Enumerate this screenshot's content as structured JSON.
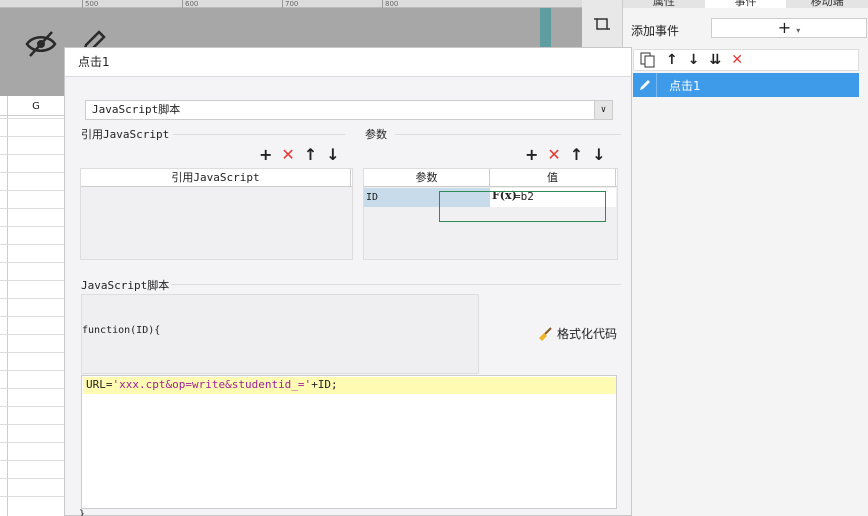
{
  "ruler": {
    "ticks": [
      "500",
      "600",
      "700",
      "800"
    ]
  },
  "grid": {
    "column_label": "G"
  },
  "side_panel": {
    "tabs": [
      "属性",
      "事件",
      "移动端"
    ],
    "add_event_label": "添加事件",
    "add_event_value": "+",
    "events": [
      "点击1"
    ]
  },
  "dialog": {
    "title": "点击1",
    "type_select": "JavaScript脚本",
    "ref_section": "引用JavaScript",
    "ref_column": "引用JavaScript",
    "param_section": "参数",
    "param_columns": [
      "参数",
      "值"
    ],
    "params": [
      {
        "name": "ID",
        "fx": "F(x)",
        "value": "=b2"
      }
    ],
    "script_section": "JavaScript脚本",
    "function_header": "function(ID){",
    "format_button": "格式化代码",
    "code": {
      "prefix": "URL=",
      "string": "'xxx.cpt&op=write&studentid_='",
      "suffix": "+ID;"
    },
    "closing": "}"
  },
  "colors": {
    "selection": "#3d9be9",
    "delete": "#e53935",
    "code_highlight": "#fffbb2",
    "string": "#a0219c"
  }
}
